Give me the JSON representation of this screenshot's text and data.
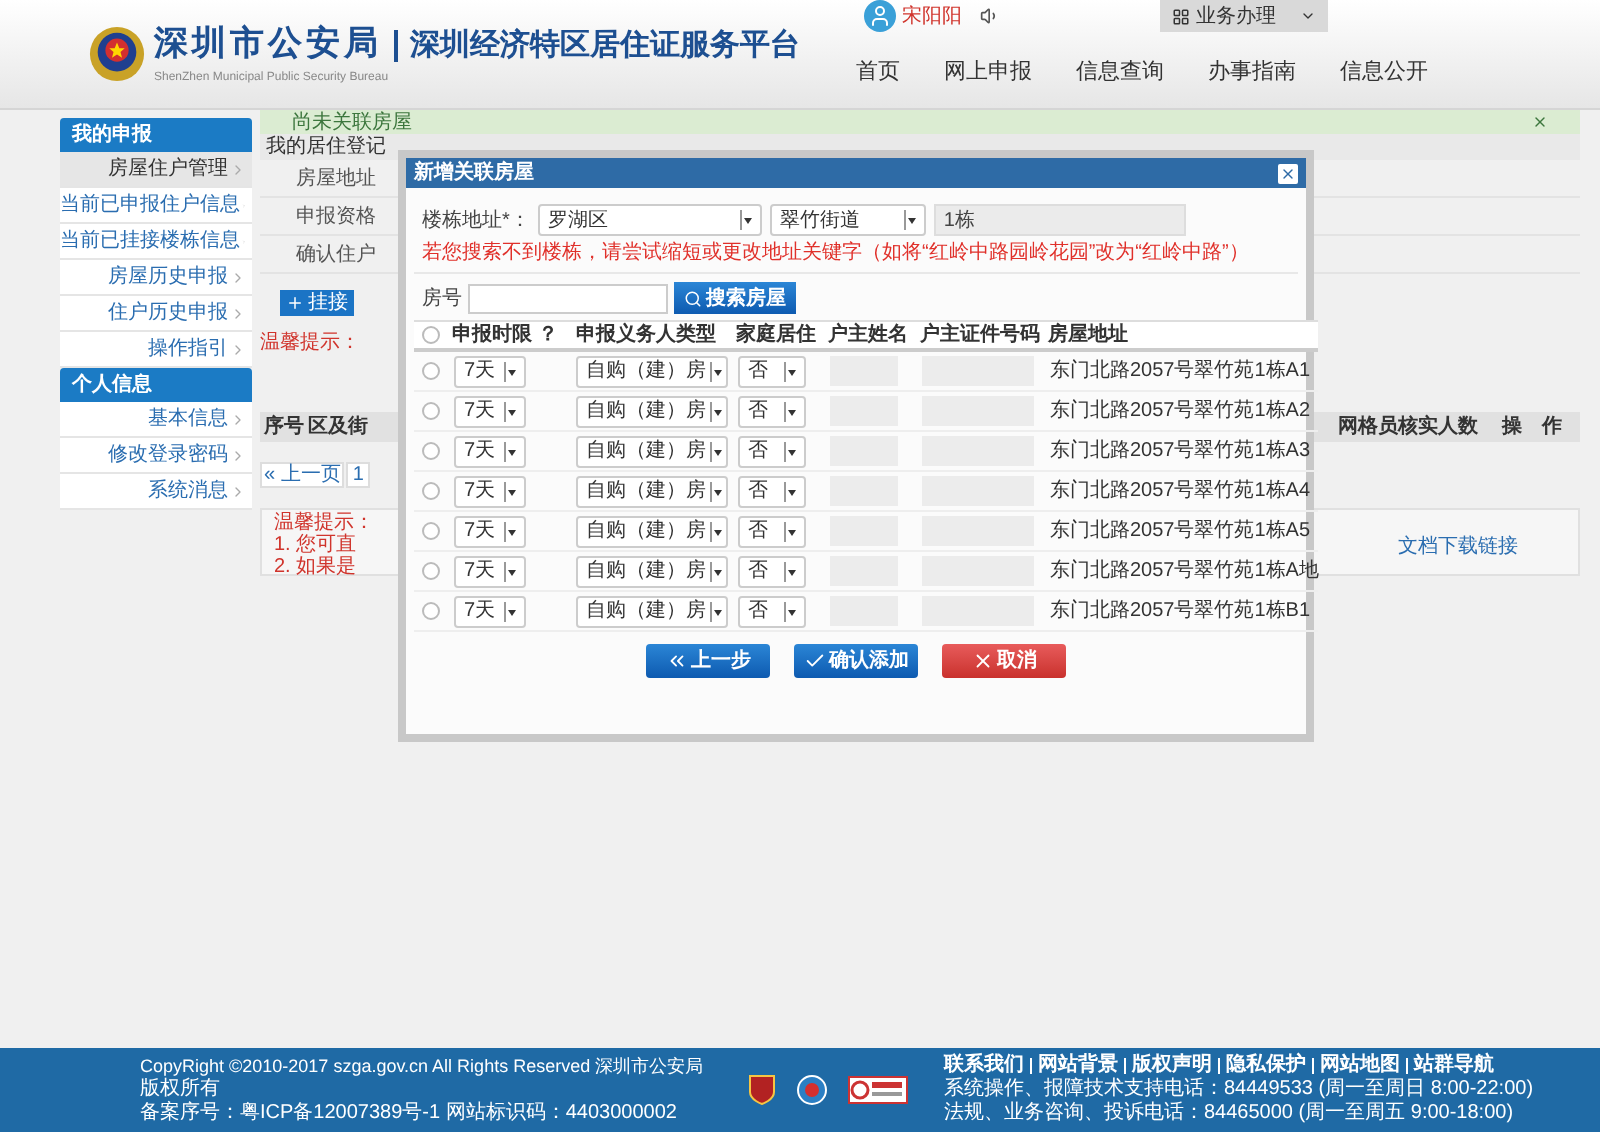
{
  "header": {
    "title": "深圳市公安局",
    "subtitle": "深圳经济特区居住证服务平台",
    "title_en": "ShenZhen Municipal Public Security Bureau",
    "user": "宋阳阳",
    "menu_button": "业务办理",
    "nav": [
      "首页",
      "网上申报",
      "信息查询",
      "办事指南",
      "信息公开"
    ]
  },
  "sidebar": {
    "sections": [
      {
        "title": "我的申报",
        "items": [
          {
            "label": "房屋住户管理",
            "selected": true
          },
          {
            "label": "当前已申报住户信息",
            "selected": false
          },
          {
            "label": "当前已挂接楼栋信息",
            "selected": false
          },
          {
            "label": "房屋历史申报",
            "selected": false
          },
          {
            "label": "住户历史申报",
            "selected": false
          },
          {
            "label": "操作指引",
            "selected": false
          }
        ]
      },
      {
        "title": "个人信息",
        "items": [
          {
            "label": "基本信息",
            "selected": false
          },
          {
            "label": "修改登录密码",
            "selected": false
          },
          {
            "label": "系统消息",
            "selected": false
          }
        ]
      }
    ]
  },
  "main": {
    "notice": "尚未关联房屋",
    "breadcrumb": "我的居住登记",
    "form_labels": [
      "房屋地址",
      "申报资格",
      "确认住户"
    ],
    "add_button": "挂接",
    "warning": "温馨提示：",
    "table_columns": [
      "序号",
      "区及街",
      "网格员核实人数",
      "操　作"
    ],
    "pagination": {
      "prev": "« 上一页",
      "page": "1"
    },
    "tips": {
      "title": "温馨提示：",
      "lines": [
        "1. 您可直",
        "2. 如果是"
      ],
      "link": "文档下载链接"
    }
  },
  "dialog": {
    "title": "新增关联房屋",
    "address_label": "楼栋地址*：",
    "district": "罗湖区",
    "street": "翠竹街道",
    "building": "1栋",
    "hint": "若您搜索不到楼栋，请尝试缩短或更改地址关键字（如将“红岭中路园岭花园”改为“红岭中路”）",
    "room_label": "房号",
    "search_button": "搜索房屋",
    "select_all_checked": false,
    "columns": [
      "申报时限 ？",
      "申报义务人类型",
      "家庭居住",
      "户主姓名",
      "户主证件号码",
      "房屋地址"
    ],
    "rows": [
      {
        "checked": false,
        "period": "7天",
        "type": "自购（建）房",
        "family": "否",
        "address": "东门北路2057号翠竹苑1栋A1"
      },
      {
        "checked": false,
        "period": "7天",
        "type": "自购（建）房",
        "family": "否",
        "address": "东门北路2057号翠竹苑1栋A2"
      },
      {
        "checked": false,
        "period": "7天",
        "type": "自购（建）房",
        "family": "否",
        "address": "东门北路2057号翠竹苑1栋A3"
      },
      {
        "checked": false,
        "period": "7天",
        "type": "自购（建）房",
        "family": "否",
        "address": "东门北路2057号翠竹苑1栋A4"
      },
      {
        "checked": false,
        "period": "7天",
        "type": "自购（建）房",
        "family": "否",
        "address": "东门北路2057号翠竹苑1栋A5"
      },
      {
        "checked": false,
        "period": "7天",
        "type": "自购（建）房",
        "family": "否",
        "address": "东门北路2057号翠竹苑1栋A地"
      },
      {
        "checked": false,
        "period": "7天",
        "type": "自购（建）房",
        "family": "否",
        "address": "东门北路2057号翠竹苑1栋B1"
      }
    ],
    "buttons": [
      {
        "kind": "back",
        "label": "上一步"
      },
      {
        "kind": "confirm",
        "label": "确认添加"
      },
      {
        "kind": "cancel",
        "label": "取消"
      }
    ]
  },
  "footer": {
    "copyright": "CopyRight ©2010-2017 szga.gov.cn All Rights Reserved 深圳市公安局",
    "rights": "版权所有",
    "icp": "备案序号：粤ICP备12007389号-1 网站标识码：4403000002",
    "links": [
      "联系我们",
      "网站背景",
      "版权声明",
      "隐私保护",
      "网站地图",
      "站群导航"
    ],
    "phones": [
      "系统操作、报障技术支持电话：84449533 (周一至周日 8:00-22:00)",
      "法规、业务咨询、投诉电话：84465000 (周一至周五 9:00-18:00)"
    ]
  }
}
